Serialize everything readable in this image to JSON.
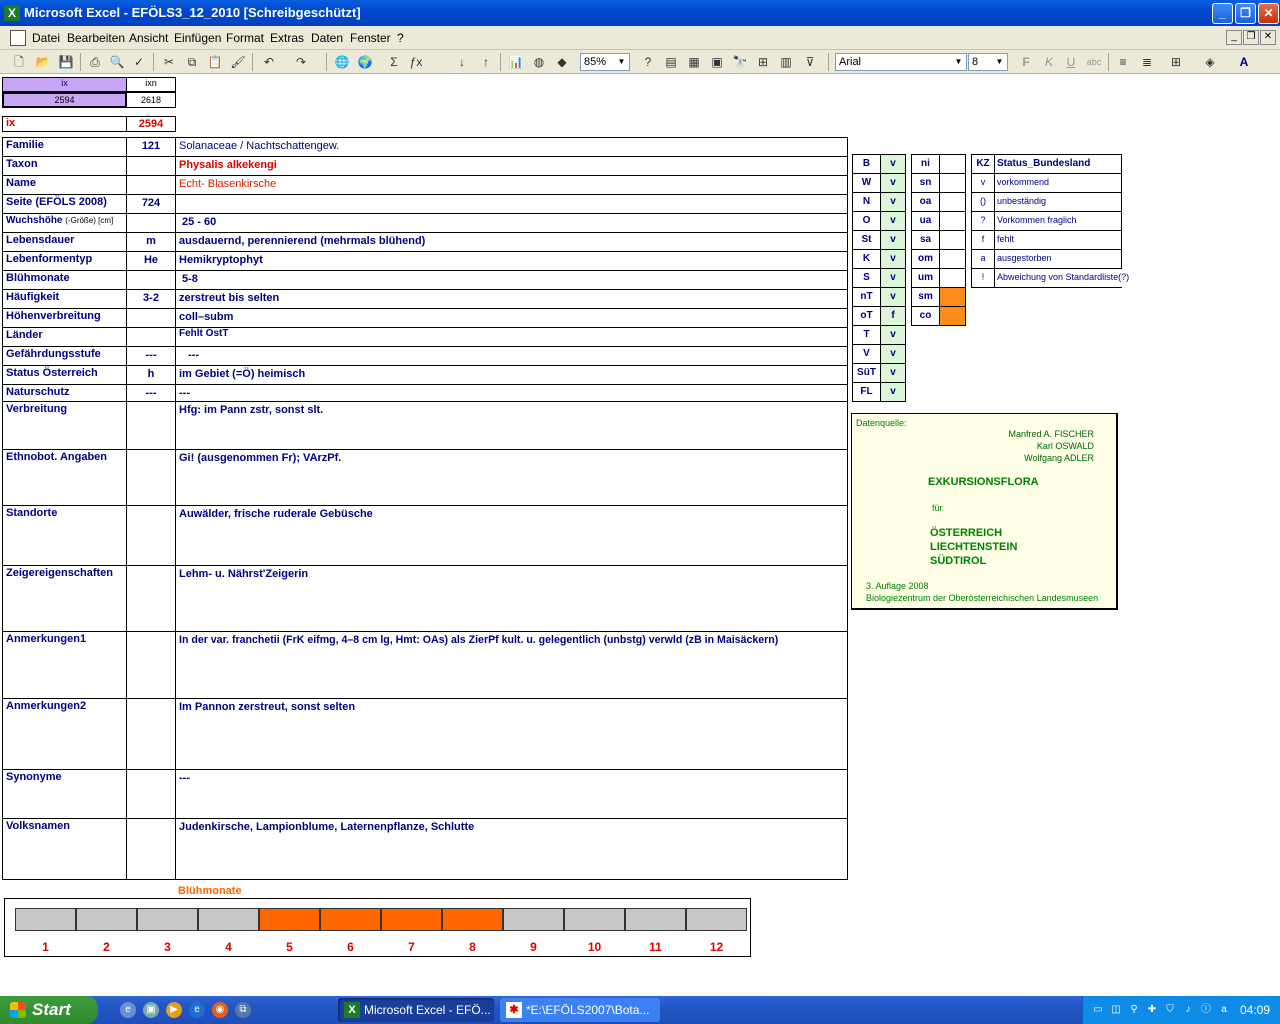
{
  "window": {
    "title": "Microsoft Excel - EFÖLS3_12_2010  [Schreibgeschützt]"
  },
  "menu": [
    "Datei",
    "Bearbeiten",
    "Ansicht",
    "Einfügen",
    "Format",
    "Extras",
    "Daten",
    "Fenster",
    "?"
  ],
  "toolbar": {
    "zoom": "85%",
    "font": "Arial",
    "font_size": "8"
  },
  "index": {
    "ix_header": "ix",
    "ixn_header": "ixn",
    "ix_value": "2594",
    "ixn_value": "2618",
    "ix_label": "ix",
    "ix_red": "2594"
  },
  "rows": [
    {
      "label": "Familie",
      "code": "121",
      "value": "Solanaceae  /  Nachtschattengew."
    },
    {
      "label": "Taxon",
      "code": "",
      "value": "Physalis alkekengi"
    },
    {
      "label": "Name",
      "code": "",
      "value": "Echt- Blasenkirsche"
    },
    {
      "label": "Seite (EFÖLS 2008)",
      "code": "724",
      "value": ""
    },
    {
      "label": "Wuchshöhe",
      "label_suffix": "(-Größe) [cm]",
      "code": "",
      "value": "25 - 60"
    },
    {
      "label": "Lebensdauer",
      "code": "m",
      "value": "ausdauernd, perennierend (mehrmals blühend)"
    },
    {
      "label": "Lebenformentyp",
      "code": "He",
      "value": "Hemikryptophyt"
    },
    {
      "label": "Blühmonate",
      "code": "",
      "value": "5-8"
    },
    {
      "label": "Häufigkeit",
      "code": "3-2",
      "value": "zerstreut bis selten"
    },
    {
      "label": "Höhenverbreitung",
      "code": "",
      "value": "coll–subm"
    },
    {
      "label": "Länder",
      "code": "",
      "value": "Fehlt OstT"
    },
    {
      "label": "Gefährdungsstufe",
      "code": "---",
      "value": "---"
    },
    {
      "label": "Status Österreich",
      "code": "h",
      "value": "im Gebiet (=Ö) heimisch"
    },
    {
      "label": "Naturschutz",
      "code": "---",
      "value": "---"
    }
  ],
  "big_rows": [
    {
      "label": "Verbreitung",
      "value": "Hfg:  im Pann zstr, sonst slt."
    },
    {
      "label": "Ethnobot. Angaben",
      "value": "Gi! (ausgenommen Fr); VArzPf."
    },
    {
      "label": "Standorte",
      "value": "Auwälder, frische ruderale Gebüsche"
    },
    {
      "label": "Zeigereigenschaften",
      "value": "Lehm- u. Nährst'Zeigerin"
    },
    {
      "label": "Anmerkungen1",
      "value": "In der var. franchetii (FrK eifmg, 4–8 cm lg, Hmt: OAs) als ZierPf kult. u. gelegentlich (unbstg) verwld (zB in Maisäckern)"
    },
    {
      "label": "Anmerkungen2",
      "value": "Im Pannon zerstreut, sonst selten"
    },
    {
      "label": "Synonyme",
      "value": "---"
    },
    {
      "label": "Volksnamen",
      "value": "Judenkirsche, Lampionblume,   Laternenpflanze, Schlutte"
    }
  ],
  "states": [
    {
      "code": "B",
      "status": "v"
    },
    {
      "code": "W",
      "status": "v"
    },
    {
      "code": "N",
      "status": "v"
    },
    {
      "code": "O",
      "status": "v"
    },
    {
      "code": "St",
      "status": "v"
    },
    {
      "code": "K",
      "status": "v"
    },
    {
      "code": "S",
      "status": "v"
    },
    {
      "code": "nT",
      "status": "v"
    },
    {
      "code": "oT",
      "status": "f"
    },
    {
      "code": "T",
      "status": "v"
    },
    {
      "code": "V",
      "status": "v"
    },
    {
      "code": "SüT",
      "status": "v"
    },
    {
      "code": "FL",
      "status": "v"
    }
  ],
  "altitude": [
    {
      "code": "ni",
      "on": false
    },
    {
      "code": "sn",
      "on": false
    },
    {
      "code": "oa",
      "on": false
    },
    {
      "code": "ua",
      "on": false
    },
    {
      "code": "sa",
      "on": false
    },
    {
      "code": "om",
      "on": false
    },
    {
      "code": "um",
      "on": false
    },
    {
      "code": "sm",
      "on": true
    },
    {
      "code": "co",
      "on": true
    }
  ],
  "legend": {
    "header_kz": "KZ",
    "header_status": "Status_Bundesland",
    "items": [
      {
        "kz": "v",
        "text": "vorkommend"
      },
      {
        "kz": "()",
        "text": "unbeständig"
      },
      {
        "kz": "?",
        "text": "Vorkommen fraglich"
      },
      {
        "kz": "f",
        "text": "fehlt"
      },
      {
        "kz": "a",
        "text": "ausgestorben"
      },
      {
        "kz": "!",
        "text": "Abweichung von Standardliste(?)"
      }
    ]
  },
  "source": {
    "label": "Datenquelle:",
    "author1": "Manfred A. FISCHER",
    "author2": "Karl OSWALD",
    "author3": "Wolfgang ADLER",
    "title": "EXKURSIONSFLORA",
    "for": "für",
    "c1": "ÖSTERREICH",
    "c2": "LIECHTENSTEIN",
    "c3": "SÜDTIROL",
    "edition": "3. Auflage 2008",
    "publisher": "Biologiezentrum der Oberösterreichischen Landesmuseen"
  },
  "bloom": {
    "title": "Blühmonate",
    "months": [
      "1",
      "2",
      "3",
      "4",
      "5",
      "6",
      "7",
      "8",
      "9",
      "10",
      "11",
      "12"
    ],
    "active": [
      5,
      6,
      7,
      8
    ]
  },
  "taskbar": {
    "start": "Start",
    "task1": "Microsoft Excel - EFÖ...",
    "task2": "*E:\\EFÖLS2007\\Bota...",
    "clock": "04:09"
  },
  "colors": {
    "accent_orange": "#ff6600",
    "green_cell": "#dff5d9",
    "label_blue": "#000080",
    "red_text": "#e00000",
    "index_purple": "#c9a6f5"
  }
}
